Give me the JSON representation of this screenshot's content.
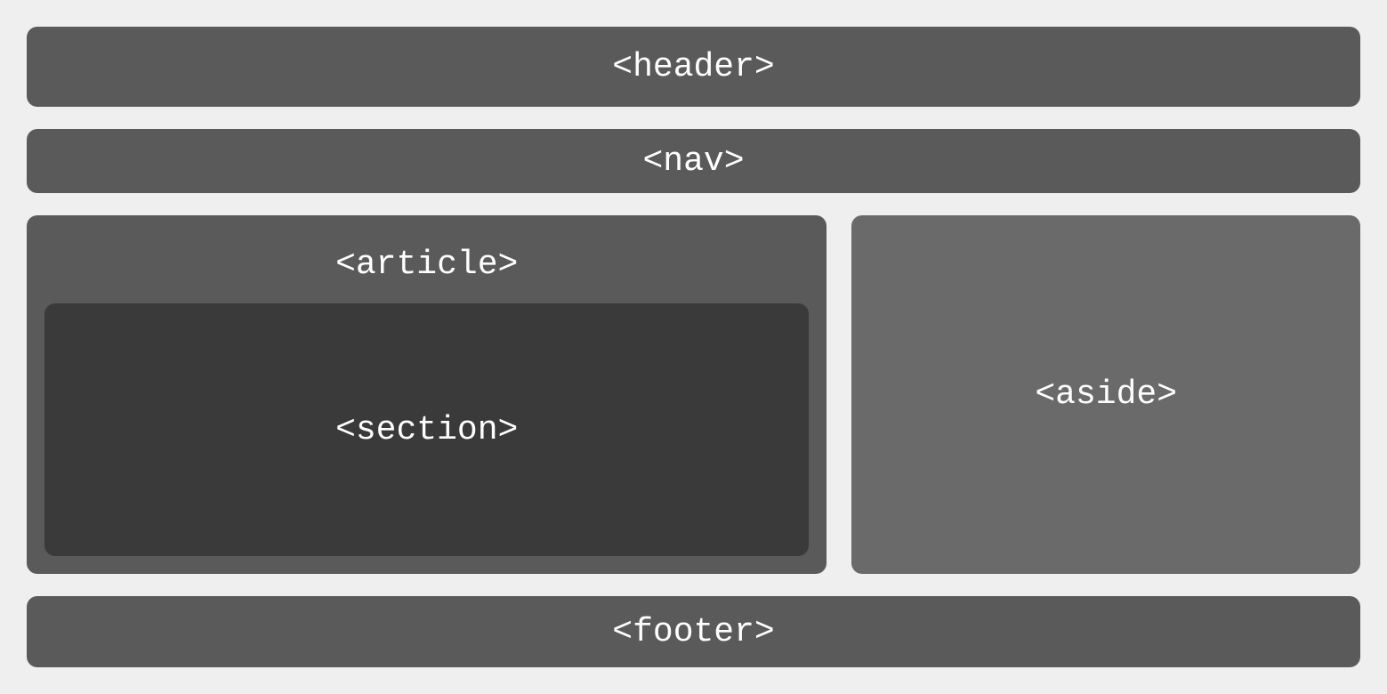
{
  "layout": {
    "header": "<header>",
    "nav": "<nav>",
    "article": "<article>",
    "section": "<section>",
    "aside": "<aside>",
    "footer": "<footer>"
  },
  "colors": {
    "background": "#efeff0",
    "box_default": "#5a5a5a",
    "box_section": "#3a3a3a",
    "box_aside": "#6a6a6a",
    "text": "#ffffff"
  }
}
